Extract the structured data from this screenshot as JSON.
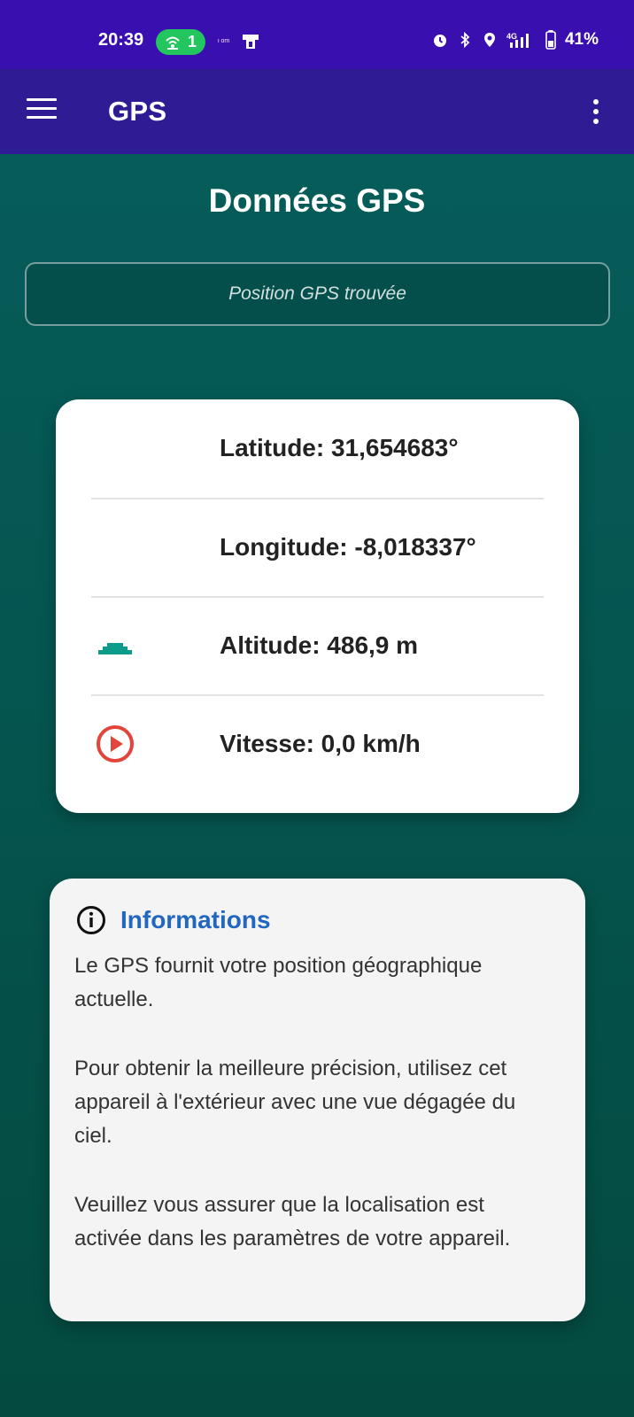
{
  "status_bar": {
    "time": "20:39",
    "hotspot_count": "1",
    "small_text": "i om",
    "battery": "41%",
    "network": "4G",
    "icons": [
      "hotspot-icon",
      "nfc-icon",
      "alarm-icon",
      "bluetooth-icon",
      "location-icon",
      "signal-icon",
      "battery-icon"
    ]
  },
  "app_bar": {
    "title": "GPS",
    "menu_icon": "hamburger-menu-icon",
    "more_icon": "more-vert-icon"
  },
  "page": {
    "title": "Données GPS",
    "status_message": "Position GPS trouvée"
  },
  "gps": {
    "latitude": "Latitude: 31,654683°",
    "longitude": "Longitude: -8,018337°",
    "altitude": "Altitude: 486,9 m",
    "speed": "Vitesse: 0,0 km/h",
    "icons": {
      "altitude": "terrain-icon",
      "speed": "speed-play-icon"
    }
  },
  "info": {
    "title": "Informations",
    "icon": "info-icon",
    "paragraph1": "Le GPS fournit votre position géographique actuelle.",
    "paragraph2": "Pour obtenir la meilleure précision, utilisez cet appareil à l'extérieur avec une vue dégagée du ciel.",
    "paragraph3": "Veuillez vous assurer que la localisation est activée dans les paramètres de votre appareil."
  },
  "colors": {
    "status_bar": "#3a0fb0",
    "app_bar": "#2f1c95",
    "background_top": "#065e5c",
    "background_bottom": "#044a40",
    "info_title": "#2166c0",
    "altitude_icon": "#0f9b8a",
    "speed_icon": "#e2463a"
  }
}
